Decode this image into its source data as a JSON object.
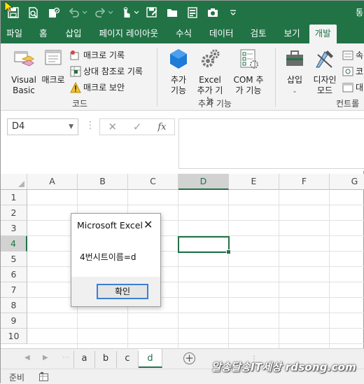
{
  "window": {
    "title_fragment": "통"
  },
  "qat": {
    "icons": [
      "save-icon",
      "print-preview-icon",
      "accessibility-icon",
      "undo-icon",
      "redo-icon",
      "touch-mode-icon",
      "save-as-icon",
      "open-icon",
      "form-icon",
      "camera-icon",
      "more-icon"
    ]
  },
  "tabs": [
    "파일",
    "홈",
    "삽입",
    "페이지 레이아웃",
    "수식",
    "데이터",
    "검토",
    "보기",
    "개발"
  ],
  "active_tab": "개발",
  "ribbon": {
    "code": {
      "visual_basic": "Visual Basic",
      "macro": "매크로",
      "record_macro": "매크로 기록",
      "relative_ref": "상대 참조로 기록",
      "macro_security": "매크로 보안",
      "group_label": "코드"
    },
    "addins": {
      "addins": "추가 기능",
      "excel_addins": "Excel 추가 기능",
      "com_addins": "COM 추가 기능",
      "group_label": "추가 기능"
    },
    "controls": {
      "insert": "삽입",
      "design_mode": "디자인 모드",
      "props_frag": "속",
      "code_frag": "코",
      "dialog_frag": "대",
      "group_label": "컨트롤"
    }
  },
  "formula_bar": {
    "name_box": "D4",
    "cancel": "✕",
    "enter": "✓",
    "fx": "fx",
    "value": ""
  },
  "grid": {
    "columns": [
      "A",
      "B",
      "C",
      "D",
      "E",
      "F",
      "G"
    ],
    "rows": [
      "1",
      "2",
      "3",
      "4",
      "5",
      "6",
      "7",
      "8",
      "9",
      "10"
    ],
    "selected_cell": "D4"
  },
  "sheets": [
    "a",
    "b",
    "c",
    "d"
  ],
  "active_sheet": "d",
  "status": {
    "mode": "준비"
  },
  "watermark": "알송달송IT세상 rdsong.com",
  "msgbox": {
    "title": "Microsoft Excel",
    "message": "4번시트이름=d",
    "ok_label": "확인"
  },
  "colors": {
    "excel_green": "#217346",
    "ribbon_bg": "#f3f3f3",
    "dialog_button_border": "#3c7fd1"
  }
}
